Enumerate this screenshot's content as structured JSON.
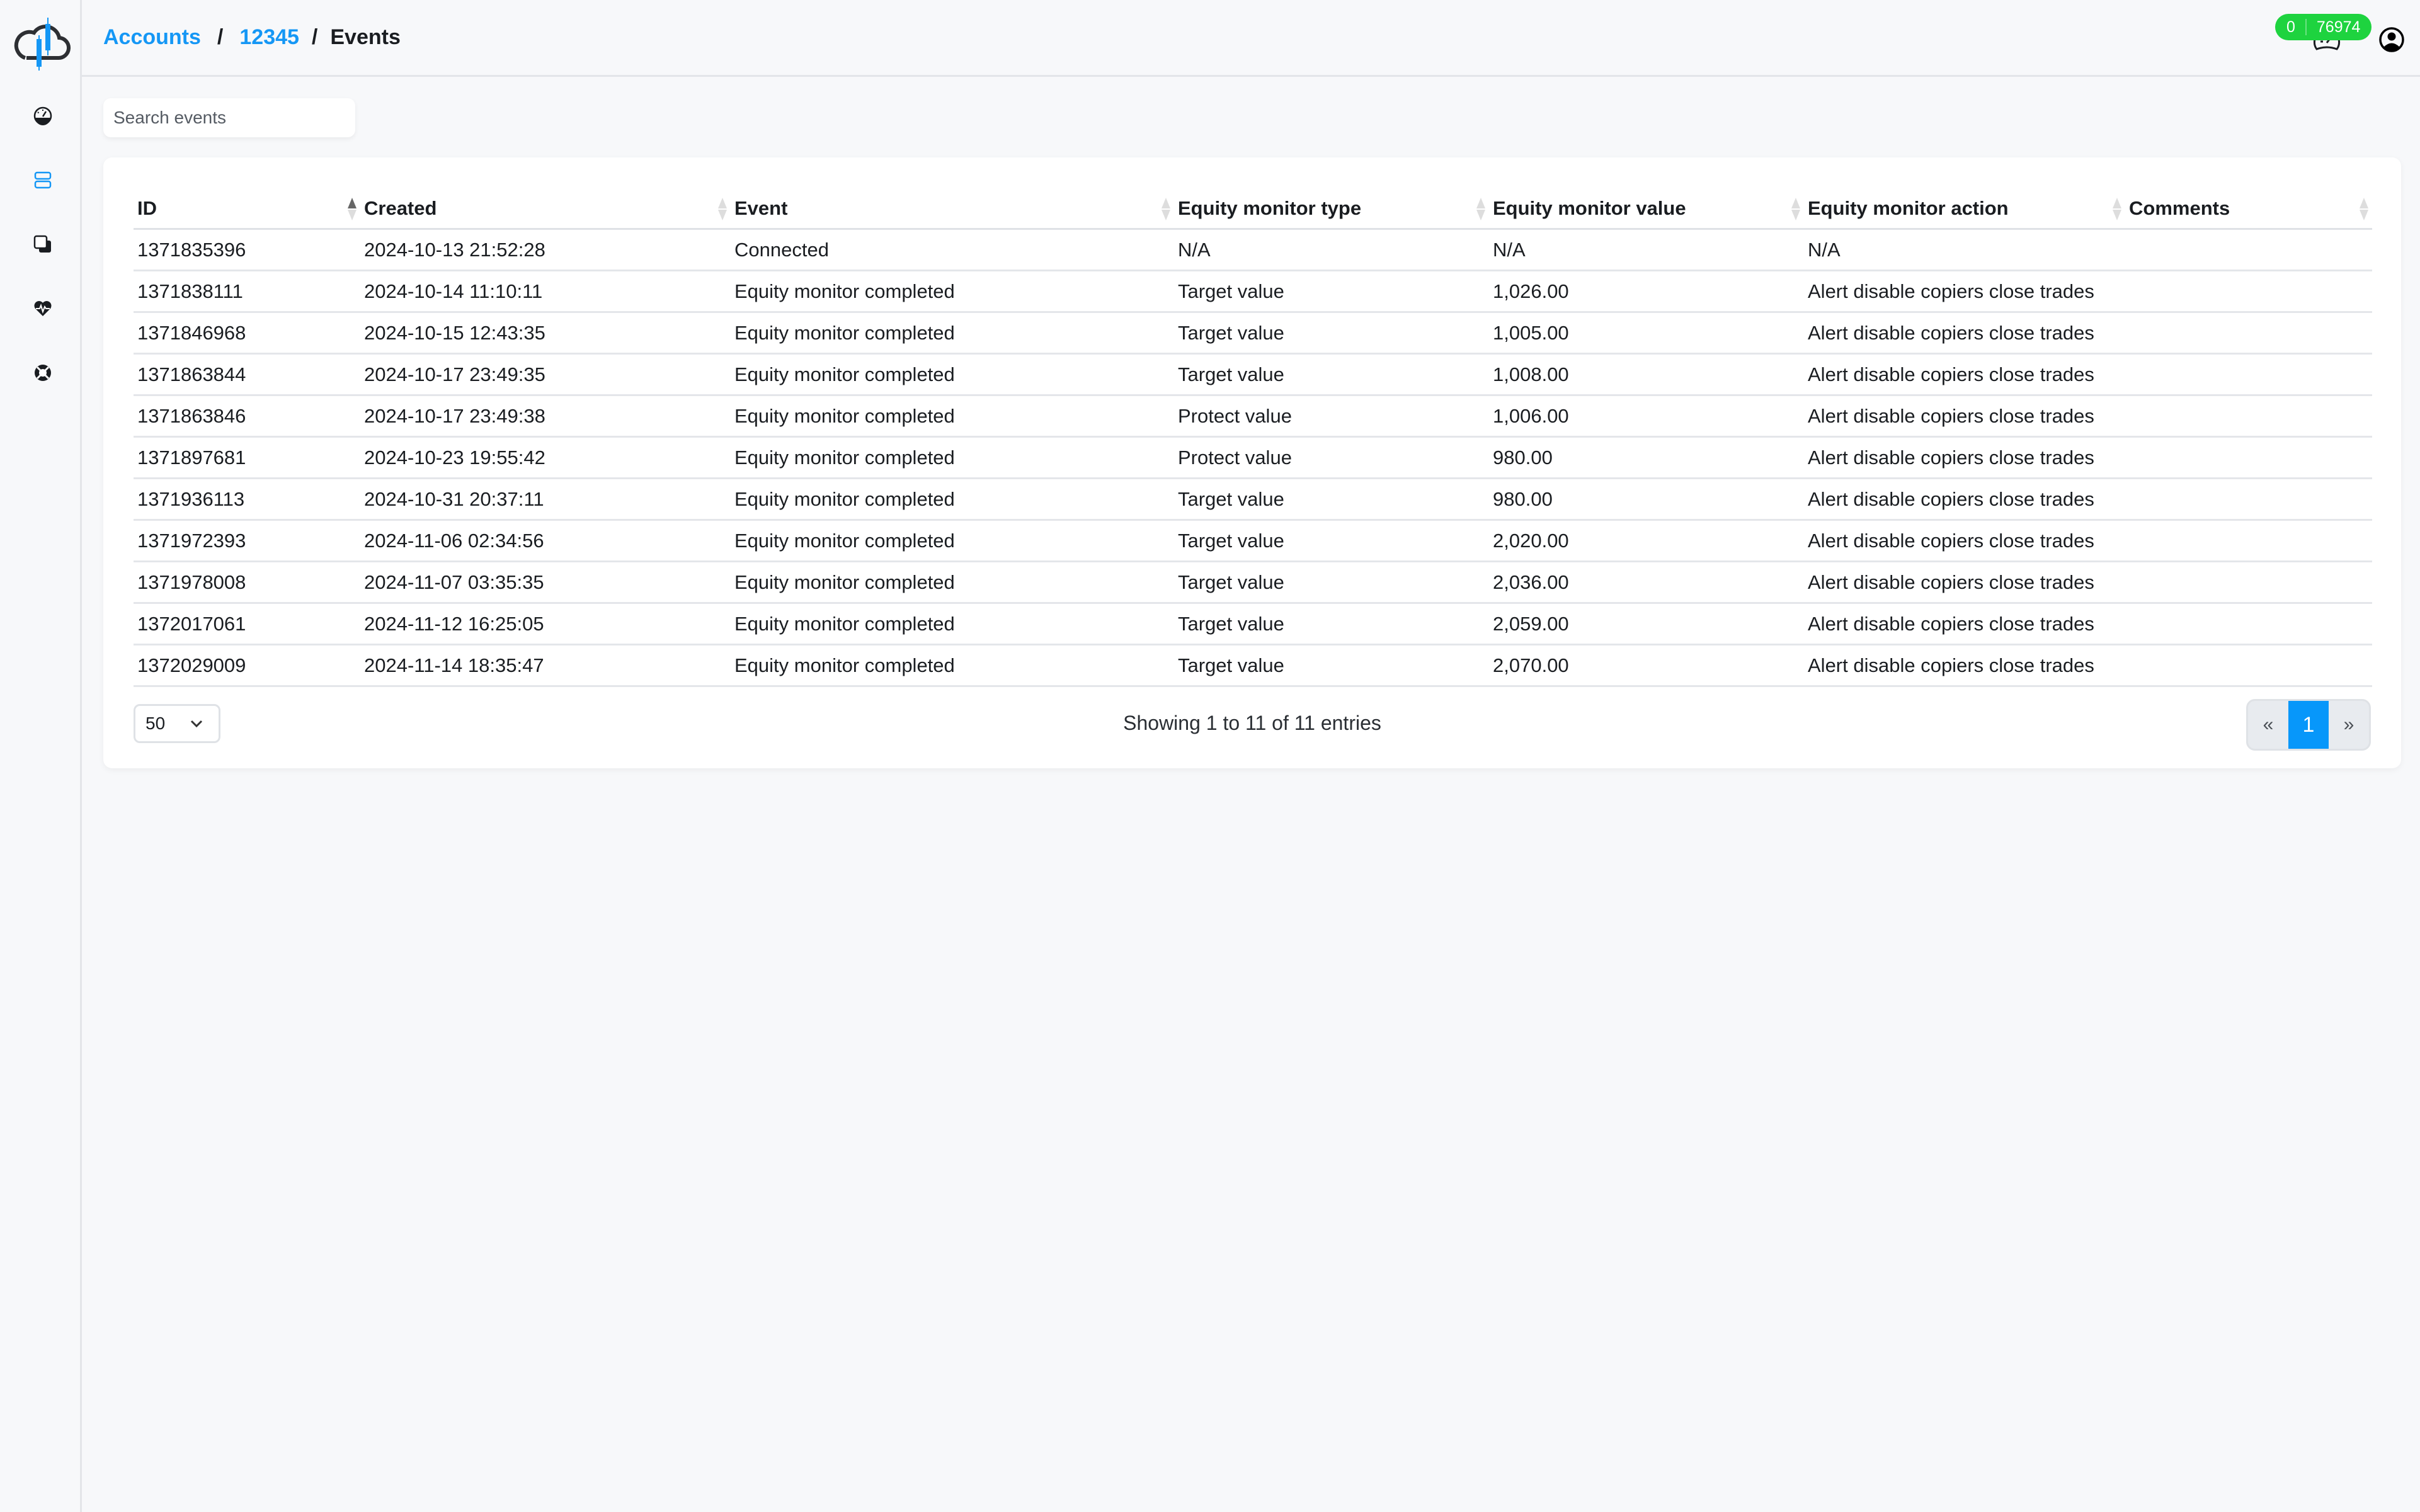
{
  "sidebar": {
    "logo": "cloud-candlestick-logo",
    "items": [
      {
        "name": "dashboard",
        "icon": "speedometer-icon",
        "active": false
      },
      {
        "name": "accounts",
        "icon": "servers-icon",
        "active": true
      },
      {
        "name": "copiers",
        "icon": "copy-icon",
        "active": false
      },
      {
        "name": "health",
        "icon": "heart-pulse-icon",
        "active": false
      },
      {
        "name": "support",
        "icon": "life-ring-icon",
        "active": false
      }
    ]
  },
  "header": {
    "breadcrumb": {
      "accounts": "Accounts",
      "account_id": "12345",
      "current": "Events",
      "separator": "/"
    },
    "badge": {
      "left": "0",
      "right": "76974"
    },
    "colors": {
      "accent": "#1597f5",
      "badge": "#1ed33f"
    }
  },
  "search": {
    "placeholder": "Search events",
    "value": ""
  },
  "table": {
    "columns": [
      "ID",
      "Created",
      "Event",
      "Equity monitor type",
      "Equity monitor value",
      "Equity monitor action",
      "Comments"
    ],
    "sorted_column": "ID",
    "sort_direction": "asc",
    "rows": [
      [
        "1371835396",
        "2024-10-13 21:52:28",
        "Connected",
        "N/A",
        "N/A",
        "N/A",
        ""
      ],
      [
        "1371838111",
        "2024-10-14 11:10:11",
        "Equity monitor completed",
        "Target value",
        "1,026.00",
        "Alert disable copiers close trades",
        ""
      ],
      [
        "1371846968",
        "2024-10-15 12:43:35",
        "Equity monitor completed",
        "Target value",
        "1,005.00",
        "Alert disable copiers close trades",
        ""
      ],
      [
        "1371863844",
        "2024-10-17 23:49:35",
        "Equity monitor completed",
        "Target value",
        "1,008.00",
        "Alert disable copiers close trades",
        ""
      ],
      [
        "1371863846",
        "2024-10-17 23:49:38",
        "Equity monitor completed",
        "Protect value",
        "1,006.00",
        "Alert disable copiers close trades",
        ""
      ],
      [
        "1371897681",
        "2024-10-23 19:55:42",
        "Equity monitor completed",
        "Protect value",
        "980.00",
        "Alert disable copiers close trades",
        ""
      ],
      [
        "1371936113",
        "2024-10-31 20:37:11",
        "Equity monitor completed",
        "Target value",
        "980.00",
        "Alert disable copiers close trades",
        ""
      ],
      [
        "1371972393",
        "2024-11-06 02:34:56",
        "Equity monitor completed",
        "Target value",
        "2,020.00",
        "Alert disable copiers close trades",
        ""
      ],
      [
        "1371978008",
        "2024-11-07 03:35:35",
        "Equity monitor completed",
        "Target value",
        "2,036.00",
        "Alert disable copiers close trades",
        ""
      ],
      [
        "1372017061",
        "2024-11-12 16:25:05",
        "Equity monitor completed",
        "Target value",
        "2,059.00",
        "Alert disable copiers close trades",
        ""
      ],
      [
        "1372029009",
        "2024-11-14 18:35:47",
        "Equity monitor completed",
        "Target value",
        "2,070.00",
        "Alert disable copiers close trades",
        ""
      ]
    ]
  },
  "footer": {
    "page_length": "50",
    "info": "Showing 1 to 11 of 11 entries",
    "pagination": {
      "prev": "«",
      "current": "1",
      "next": "»"
    }
  }
}
